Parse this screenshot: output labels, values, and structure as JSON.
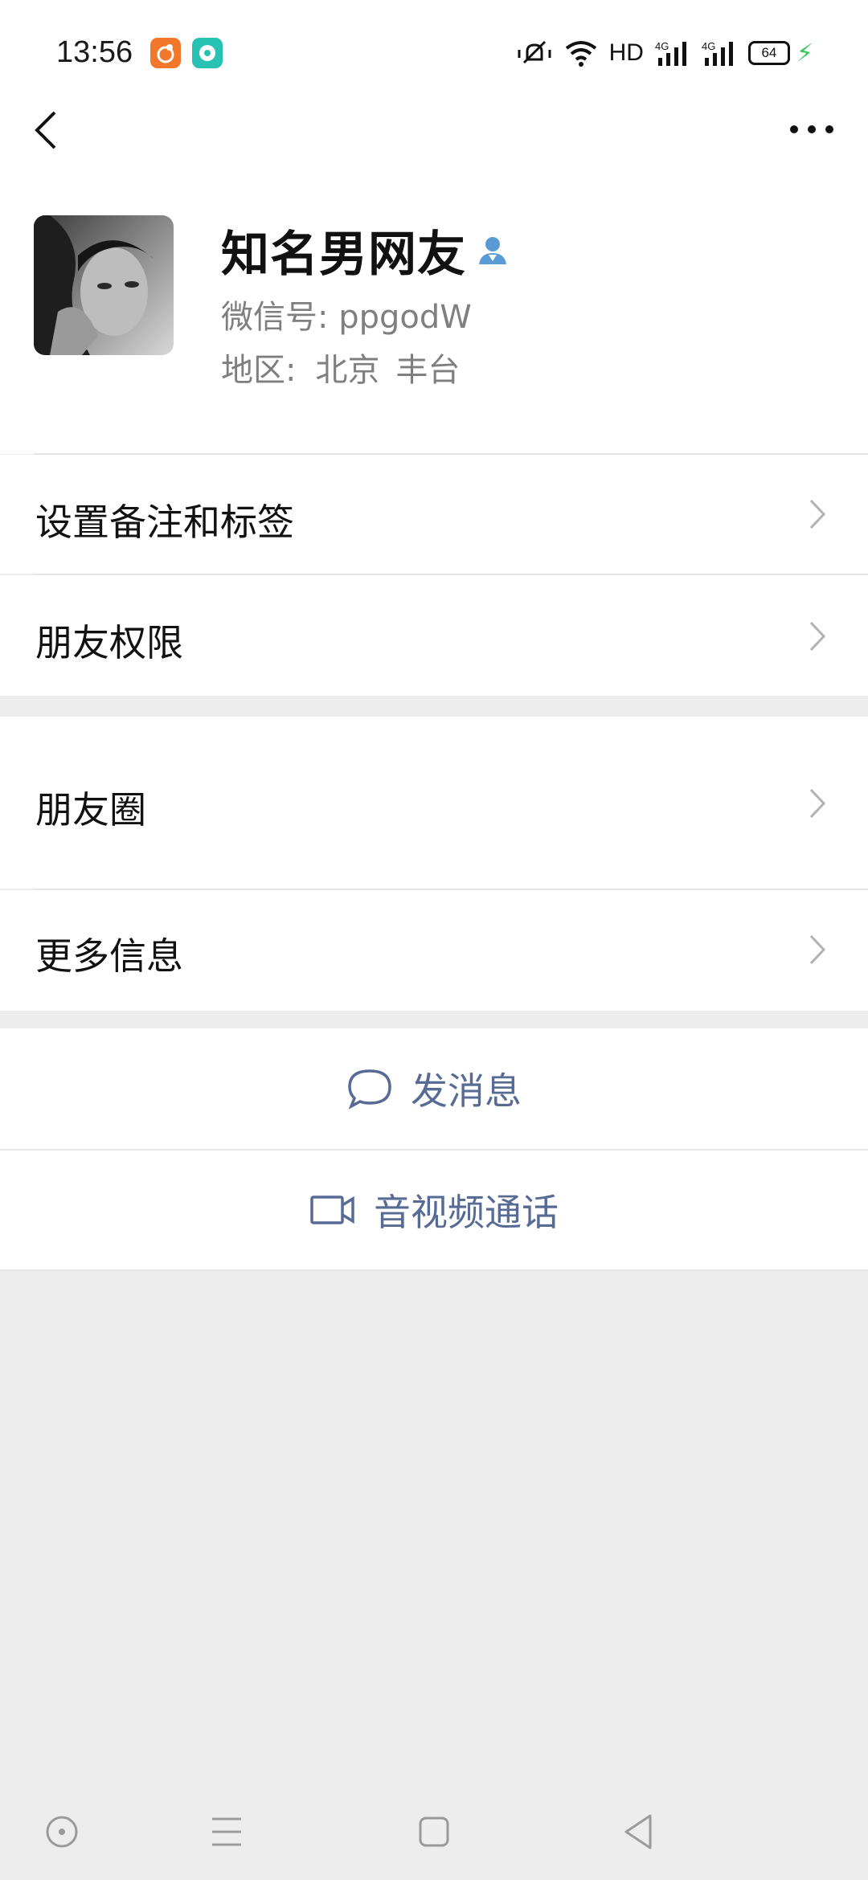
{
  "status_bar": {
    "time": "13:56",
    "network_label": "HD",
    "battery_level": "64",
    "icons": [
      "uc-browser-app-icon",
      "message-app-icon",
      "vibrate-icon",
      "wifi-icon",
      "signal-4g-icon",
      "signal-4g-icon",
      "battery-icon",
      "charging-icon"
    ]
  },
  "header": {
    "back_icon": "back-arrow-icon",
    "more_icon": "more-dots-icon"
  },
  "profile": {
    "nickname": "知名男网友",
    "wechat_id_label": "微信号:",
    "wechat_id": "ppgodW",
    "region_label": "地区:",
    "region_city": "北京",
    "region_district": "丰台"
  },
  "menu": {
    "set_remark": "设置备注和标签",
    "friend_permission": "朋友权限",
    "moments": "朋友圈",
    "more_info": "更多信息"
  },
  "actions": {
    "send_message": "发消息",
    "video_call": "音视频通话"
  },
  "colors": {
    "link_blue": "#576b95",
    "background": "#ededed",
    "verify_blue": "#5b9bd5"
  }
}
